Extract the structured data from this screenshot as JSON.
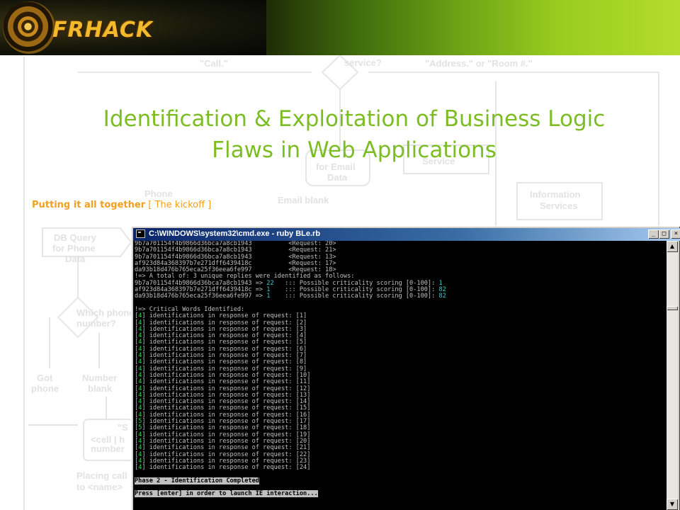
{
  "banner": {
    "logo_text": "FRHACK"
  },
  "background_flowchart": {
    "labels": [
      "\"Call.\"",
      "service?",
      "\"Address.\" or \"Room #.\"",
      "for Email",
      "Data",
      "Service",
      "Phone",
      "Email blank",
      "Information",
      "Services",
      "DB Query",
      "for Phone",
      "Data",
      "Which phone",
      "number?",
      "Got",
      "phone",
      "Number",
      "blank",
      "\"S",
      "<cell | h",
      "number",
      "Placing call",
      "to <name>"
    ]
  },
  "slide": {
    "title_line1": "Identification & Exploitation of Business Logic",
    "title_line2": "Flaws in Web Applications",
    "subtitle_bold": "Putting it all together",
    "subtitle_rest": " [ The kickoff ]"
  },
  "cmd_window": {
    "title": "C:\\WINDOWS\\system32\\cmd.exe - ruby BLe.rb",
    "controls": {
      "minimize": "_",
      "maximize": "□",
      "close": "×"
    },
    "scroll_up": "▲",
    "scroll_down": "▼",
    "lines": [
      [
        {
          "t": "9b7a701154f4b9866d36bca7a8cb1943          <Request: 20>"
        }
      ],
      [
        {
          "t": "9b7a701154f4b9866d36bca7a8cb1943          <Request: 21>"
        }
      ],
      [
        {
          "t": "9b7a701154f4b9866d36bca7a8cb1943          <Request: 13>"
        }
      ],
      [
        {
          "t": "af923d84a368397b7e271dff6439418c          <Request: 17>"
        }
      ],
      [
        {
          "t": "da93b18d476b765eca25f36eea6fe997          <Request: 18>"
        }
      ],
      [
        {
          "t": "!=> A total of: 3 unique replies were identified as follows:"
        }
      ],
      [
        {
          "t": "9b7a701154f4b9866d36bca7a8cb1943 => "
        },
        {
          "t": "22",
          "c": "cyan"
        },
        {
          "t": "   ::: Possible criticality scoring [0-100]: "
        },
        {
          "t": "1",
          "c": "cyan"
        }
      ],
      [
        {
          "t": "af923d84a368397b7e271dff6439418c => "
        },
        {
          "t": "1",
          "c": "cyan"
        },
        {
          "t": "    ::: Possible criticality scoring [0-100]: "
        },
        {
          "t": "82",
          "c": "cyan"
        }
      ],
      [
        {
          "t": "da93b18d476b765eca25f36eea6fe997 => "
        },
        {
          "t": "1",
          "c": "cyan"
        },
        {
          "t": "    ::: Possible criticality scoring [0-100]: "
        },
        {
          "t": "82",
          "c": "cyan"
        }
      ],
      [
        {
          "t": ""
        }
      ],
      [
        {
          "t": "!=> Critical Words Identified:"
        }
      ],
      [
        {
          "t": "["
        },
        {
          "t": "4",
          "c": "green"
        },
        {
          "t": "] identifications in response of request: [1]"
        }
      ],
      [
        {
          "t": "["
        },
        {
          "t": "4",
          "c": "green"
        },
        {
          "t": "] identifications in response of request: [2]"
        }
      ],
      [
        {
          "t": "["
        },
        {
          "t": "4",
          "c": "green"
        },
        {
          "t": "] identifications in response of request: [3]"
        }
      ],
      [
        {
          "t": "["
        },
        {
          "t": "4",
          "c": "green"
        },
        {
          "t": "] identifications in response of request: [4]"
        }
      ],
      [
        {
          "t": "["
        },
        {
          "t": "4",
          "c": "green"
        },
        {
          "t": "] identifications in response of request: [5]"
        }
      ],
      [
        {
          "t": "["
        },
        {
          "t": "4",
          "c": "green"
        },
        {
          "t": "] identifications in response of request: [6]"
        }
      ],
      [
        {
          "t": "["
        },
        {
          "t": "4",
          "c": "green"
        },
        {
          "t": "] identifications in response of request: [7]"
        }
      ],
      [
        {
          "t": "["
        },
        {
          "t": "4",
          "c": "green"
        },
        {
          "t": "] identifications in response of request: [8]"
        }
      ],
      [
        {
          "t": "["
        },
        {
          "t": "4",
          "c": "green"
        },
        {
          "t": "] identifications in response of request: [9]"
        }
      ],
      [
        {
          "t": "["
        },
        {
          "t": "4",
          "c": "green"
        },
        {
          "t": "] identifications in response of request: [10]"
        }
      ],
      [
        {
          "t": "["
        },
        {
          "t": "4",
          "c": "green"
        },
        {
          "t": "] identifications in response of request: [11]"
        }
      ],
      [
        {
          "t": "["
        },
        {
          "t": "4",
          "c": "green"
        },
        {
          "t": "] identifications in response of request: [12]"
        }
      ],
      [
        {
          "t": "["
        },
        {
          "t": "4",
          "c": "green"
        },
        {
          "t": "] identifications in response of request: [13]"
        }
      ],
      [
        {
          "t": "["
        },
        {
          "t": "4",
          "c": "green"
        },
        {
          "t": "] identifications in response of request: [14]"
        }
      ],
      [
        {
          "t": "["
        },
        {
          "t": "4",
          "c": "green"
        },
        {
          "t": "] identifications in response of request: [15]"
        }
      ],
      [
        {
          "t": "["
        },
        {
          "t": "4",
          "c": "green"
        },
        {
          "t": "] identifications in response of request: [16]"
        }
      ],
      [
        {
          "t": "["
        },
        {
          "t": "5",
          "c": "green"
        },
        {
          "t": "] identifications in response of request: [17]"
        }
      ],
      [
        {
          "t": "["
        },
        {
          "t": "5",
          "c": "green"
        },
        {
          "t": "] identifications in response of request: [18]"
        }
      ],
      [
        {
          "t": "["
        },
        {
          "t": "4",
          "c": "green"
        },
        {
          "t": "] identifications in response of request: [19]"
        }
      ],
      [
        {
          "t": "["
        },
        {
          "t": "4",
          "c": "green"
        },
        {
          "t": "] identifications in response of request: [20]"
        }
      ],
      [
        {
          "t": "["
        },
        {
          "t": "4",
          "c": "green"
        },
        {
          "t": "] identifications in response of request: [21]"
        }
      ],
      [
        {
          "t": "["
        },
        {
          "t": "4",
          "c": "green"
        },
        {
          "t": "] identifications in response of request: [22]"
        }
      ],
      [
        {
          "t": "["
        },
        {
          "t": "4",
          "c": "green"
        },
        {
          "t": "] identifications in response of request: [23]"
        }
      ],
      [
        {
          "t": "["
        },
        {
          "t": "4",
          "c": "green"
        },
        {
          "t": "] identifications in response of request: [24]"
        }
      ],
      [
        {
          "t": ""
        }
      ],
      [
        {
          "t": "Phase 2 - Identification Completed",
          "c": "hl"
        }
      ],
      [
        {
          "t": ""
        }
      ],
      [
        {
          "t": "Press [enter] in order to launch IE interaction...",
          "c": "hl"
        }
      ]
    ]
  }
}
